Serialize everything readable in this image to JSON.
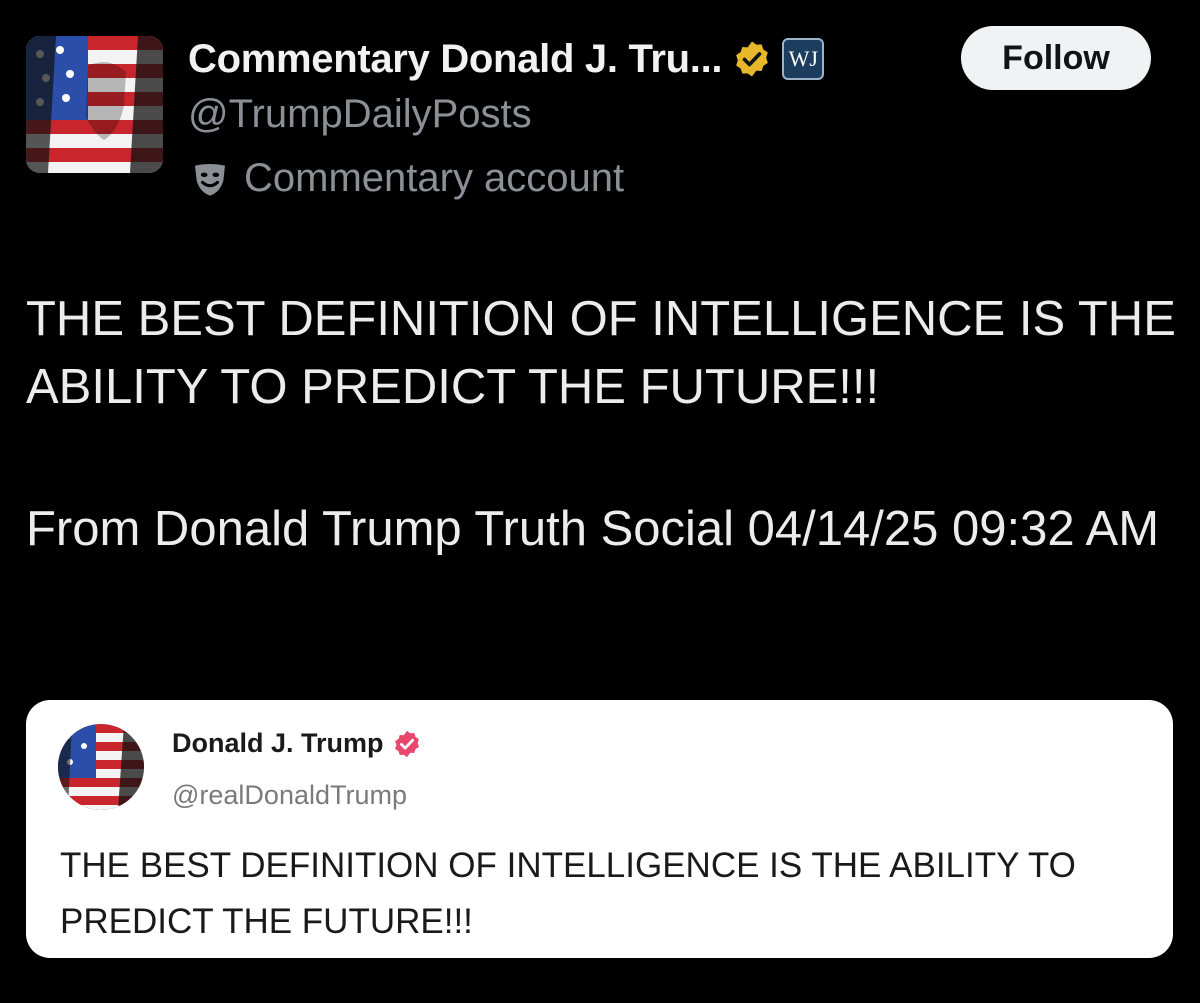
{
  "post": {
    "author": {
      "display_name": "Commentary Donald J. Tru...",
      "handle": "@TrumpDailyPosts",
      "account_label": "Commentary account",
      "affiliate_badge": "WJ",
      "verified_color": "#e8b82a",
      "avatar_icon": "flag-portrait-avatar",
      "label_icon": "theater-mask-icon"
    },
    "follow_label": "Follow",
    "text": "THE BEST DEFINITION OF INTELLIGENCE IS THE ABILITY TO PREDICT THE FUTURE!!!",
    "source": "From Donald Trump Truth Social 04/14/25 09:32 AM"
  },
  "quoted_post": {
    "author": {
      "display_name": "Donald J. Trump",
      "handle": "@realDonaldTrump",
      "verified_color": "#e8466a"
    },
    "text": "THE BEST DEFINITION OF INTELLIGENCE IS THE ABILITY TO PREDICT THE FUTURE!!!"
  }
}
